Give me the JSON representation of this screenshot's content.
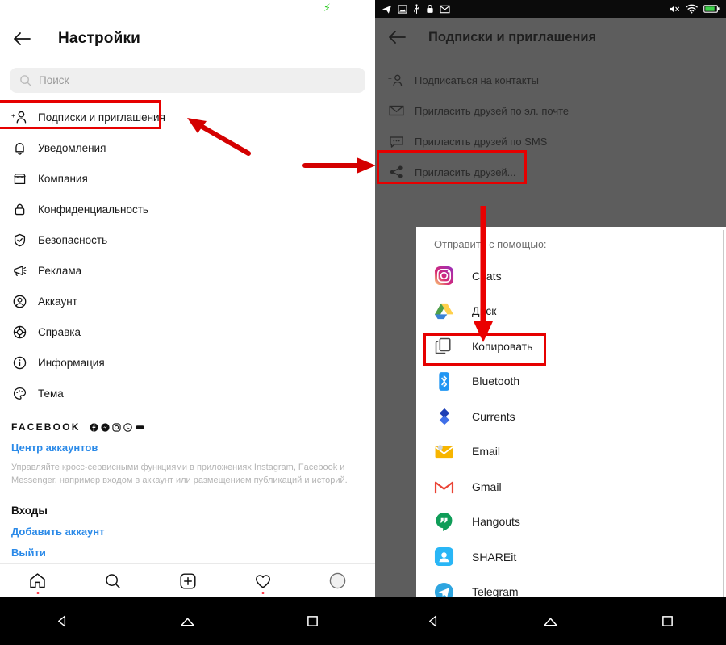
{
  "left_phone": {
    "status_bar": {
      "charging_icon": "bolt-icon"
    },
    "header": {
      "back": "back-arrow-icon",
      "title": "Настройки"
    },
    "search": {
      "placeholder": "Поиск",
      "icon": "search-icon"
    },
    "menu_items": [
      {
        "label": "Подписки и приглашения",
        "icon": "person-add-icon",
        "highlighted": true
      },
      {
        "label": "Уведомления",
        "icon": "bell-icon"
      },
      {
        "label": "Компания",
        "icon": "store-icon"
      },
      {
        "label": "Конфиденциальность",
        "icon": "lock-icon"
      },
      {
        "label": "Безопасность",
        "icon": "shield-check-icon"
      },
      {
        "label": "Реклама",
        "icon": "megaphone-icon"
      },
      {
        "label": "Аккаунт",
        "icon": "account-circle-icon"
      },
      {
        "label": "Справка",
        "icon": "lifebuoy-icon"
      },
      {
        "label": "Информация",
        "icon": "info-circle-icon"
      },
      {
        "label": "Тема",
        "icon": "palette-icon"
      }
    ],
    "facebook_section": {
      "brand": "FACEBOOK",
      "brand_icons": [
        "facebook-icon",
        "messenger-icon",
        "instagram-icon",
        "whatsapp-icon",
        "oculus-icon"
      ],
      "accounts_center_link": "Центр аккаунтов",
      "description": "Управляйте кросс-сервисными функциями в приложениях Instagram, Facebook и Messenger, например входом в аккаунт или размещением публикаций и историй."
    },
    "logins_section": {
      "heading": "Входы",
      "add_account_link": "Добавить аккаунт",
      "logout_link": "Выйти"
    },
    "bottom_nav": [
      {
        "icon": "home-icon",
        "badge": true
      },
      {
        "icon": "search-icon",
        "badge": false
      },
      {
        "icon": "add-box-icon",
        "badge": false
      },
      {
        "icon": "heart-icon",
        "badge": true
      },
      {
        "icon": "avatar-icon",
        "badge": false
      }
    ],
    "system_nav": [
      "back-triangle-icon",
      "home-circle-icon",
      "recents-square-icon"
    ]
  },
  "right_phone": {
    "status_bar": {
      "left_icons": [
        "telegram-icon",
        "screenshot-icon",
        "usb-icon",
        "lock-icon",
        "mail-icon"
      ],
      "right_icons": [
        "mute-icon",
        "wifi-icon",
        "battery-icon"
      ]
    },
    "header": {
      "back": "back-arrow-icon",
      "title": "Подписки и приглашения"
    },
    "menu_items": [
      {
        "label": "Подписаться на контакты",
        "icon": "person-add-icon"
      },
      {
        "label": "Пригласить друзей по эл. почте",
        "icon": "envelope-icon"
      },
      {
        "label": "Пригласить друзей по SMS",
        "icon": "sms-bubble-icon"
      },
      {
        "label": "Пригласить друзей...",
        "icon": "share-icon",
        "highlighted": true
      }
    ],
    "share_sheet": {
      "title": "Отправить с помощью:",
      "apps": [
        {
          "label": "Chats",
          "icon": "instagram-icon",
          "highlighted": false
        },
        {
          "label": "Диск",
          "icon": "google-drive-icon",
          "highlighted": false
        },
        {
          "label": "Копировать",
          "icon": "copy-icon",
          "highlighted": true
        },
        {
          "label": "Bluetooth",
          "icon": "bluetooth-icon",
          "highlighted": false
        },
        {
          "label": "Currents",
          "icon": "currents-icon",
          "highlighted": false
        },
        {
          "label": "Email",
          "icon": "email-icon",
          "highlighted": false
        },
        {
          "label": "Gmail",
          "icon": "gmail-icon",
          "highlighted": false
        },
        {
          "label": "Hangouts",
          "icon": "hangouts-icon",
          "highlighted": false
        },
        {
          "label": "SHAREit",
          "icon": "shareit-icon",
          "highlighted": false
        },
        {
          "label": "Telegram",
          "icon": "telegram-icon",
          "highlighted": false
        }
      ]
    },
    "system_nav": [
      "back-triangle-icon",
      "home-circle-icon",
      "recents-square-icon"
    ]
  },
  "annotations": {
    "highlight_color": "#e60000",
    "arrows": [
      {
        "name": "arrow-to-subscriptions",
        "direction": "up-left"
      },
      {
        "name": "arrow-to-invite-friends",
        "direction": "right"
      },
      {
        "name": "arrow-to-copy",
        "direction": "down"
      }
    ]
  }
}
